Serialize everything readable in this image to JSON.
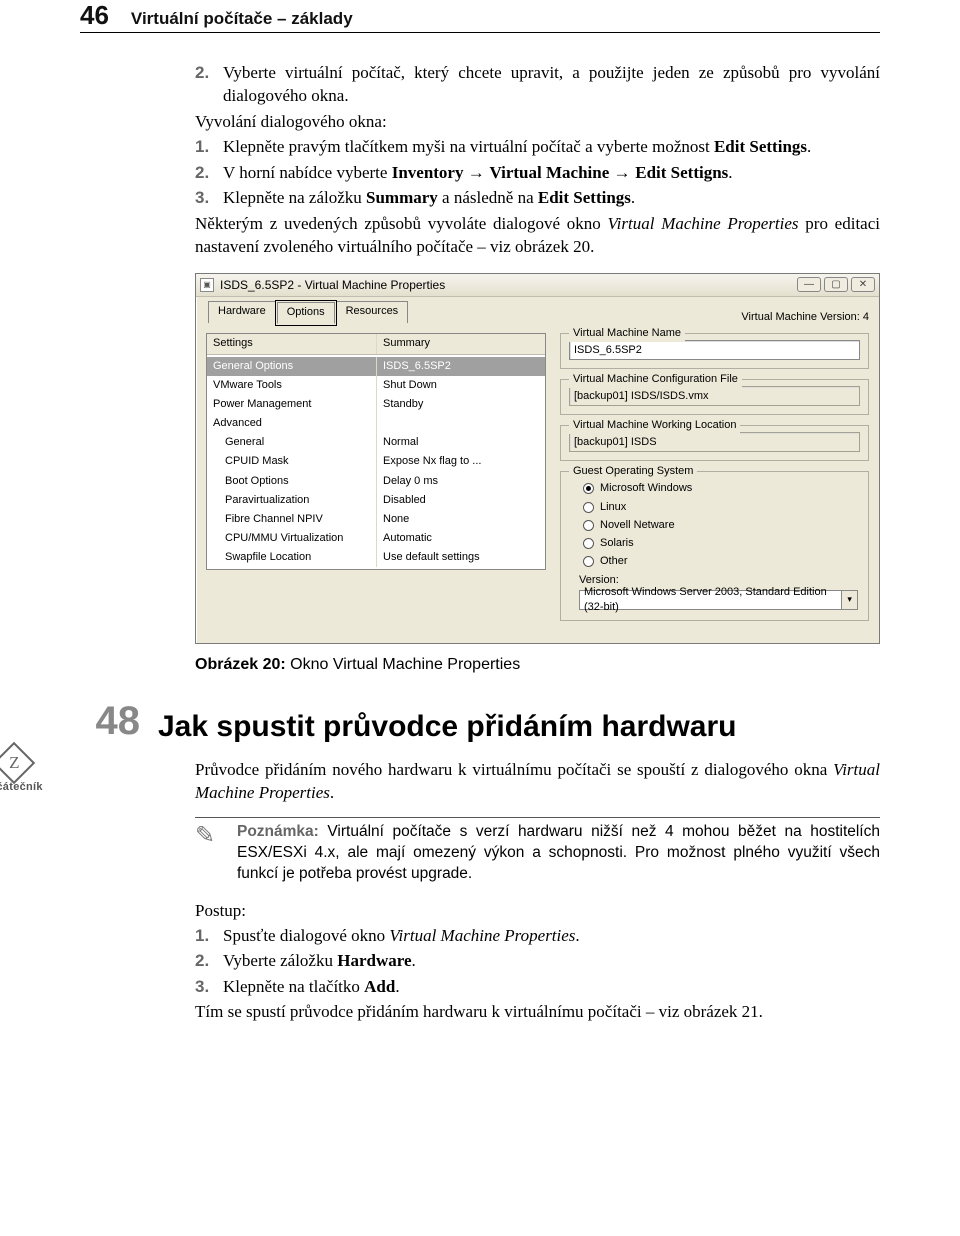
{
  "header": {
    "page": "46",
    "title": "Virtuální počítače – základy"
  },
  "top": {
    "item2": "Vyberte virtuální počítač, který chcete upravit, a použijte jeden ze způsobů pro vyvolání dialogového okna.",
    "subhead": "Vyvolání dialogového okna:",
    "s1_a": "Klepněte pravým tlačítkem myši na virtuální počítač a vyberte možnost ",
    "s1_b": "Edit Settings",
    "s2_a": "V horní nabídce vyberte ",
    "s2_b": "Inventory",
    "s2_c": "Virtual Machine",
    "s2_d": "Edit Settigns",
    "s3_a": "Klepněte na záložku ",
    "s3_b": "Summary",
    "s3_c": " a následně na ",
    "s3_d": "Edit Settings",
    "tail1": "Některým z uvedených způsobů vyvoláte dialogové okno ",
    "tail_i": "Virtual Machine Properties",
    "tail2": " pro editaci nastavení zvoleného virtuálního počítače – viz obrázek 20."
  },
  "dialog": {
    "title": "ISDS_6.5SP2 - Virtual Machine Properties",
    "tabs": {
      "hw": "Hardware",
      "opt": "Options",
      "res": "Resources"
    },
    "version": "Virtual Machine Version: 4",
    "cols": {
      "settings": "Settings",
      "summary": "Summary"
    },
    "rows": [
      {
        "s": "General Options",
        "m": "ISDS_6.5SP2",
        "sel": true
      },
      {
        "s": "VMware Tools",
        "m": "Shut Down"
      },
      {
        "s": "Power Management",
        "m": "Standby"
      },
      {
        "s": "Advanced",
        "m": ""
      },
      {
        "s": "General",
        "m": "Normal",
        "ind": true
      },
      {
        "s": "CPUID Mask",
        "m": "Expose Nx flag to ...",
        "ind": true
      },
      {
        "s": "Boot Options",
        "m": "Delay 0 ms",
        "ind": true
      },
      {
        "s": "Paravirtualization",
        "m": "Disabled",
        "ind": true
      },
      {
        "s": "Fibre Channel NPIV",
        "m": "None",
        "ind": true
      },
      {
        "s": "CPU/MMU Virtualization",
        "m": "Automatic",
        "ind": true
      },
      {
        "s": "Swapfile Location",
        "m": "Use default settings",
        "ind": true
      }
    ],
    "vmName": {
      "legend": "Virtual Machine Name",
      "value": "ISDS_6.5SP2"
    },
    "vmConf": {
      "legend": "Virtual Machine Configuration File",
      "value": "[backup01] ISDS/ISDS.vmx"
    },
    "vmWork": {
      "legend": "Virtual Machine Working Location",
      "value": "[backup01] ISDS"
    },
    "guest": {
      "legend": "Guest Operating System",
      "opts": [
        "Microsoft Windows",
        "Linux",
        "Novell Netware",
        "Solaris",
        "Other"
      ],
      "versionLabel": "Version:",
      "versionValue": "Microsoft Windows Server 2003, Standard Edition (32-bit)"
    }
  },
  "caption": {
    "b": "Obrázek 20:",
    "t": " Okno Virtual Machine Properties"
  },
  "tip": {
    "num": "48",
    "title": "Jak spustit průvodce přidáním hardwaru",
    "z": "začátečník",
    "intro1": "Průvodce přidáním nového hardwaru k virtuálnímu počítači se spouští z dialogového okna ",
    "intro_i": "Virtual Machine Properties",
    "note_label": "Poznámka:",
    "note": " Virtuální počítače s verzí hardwaru nižší než 4 mohou běžet na hostitelích ESX/ESXi 4.x, ale mají omezený výkon a schopnosti. Pro možnost plného využití všech funkcí je potřeba provést upgrade.",
    "postup": "Postup:",
    "p1a": "Spusťte dialogové okno ",
    "p1b": "Virtual Machine Properties",
    "p2a": "Vyberte záložku ",
    "p2b": "Hardware",
    "p3a": "Klepněte na tlačítko ",
    "p3b": "Add",
    "end": "Tím se spustí průvodce přidáním hardwaru k virtuálnímu počítači – viz obrázek 21."
  }
}
